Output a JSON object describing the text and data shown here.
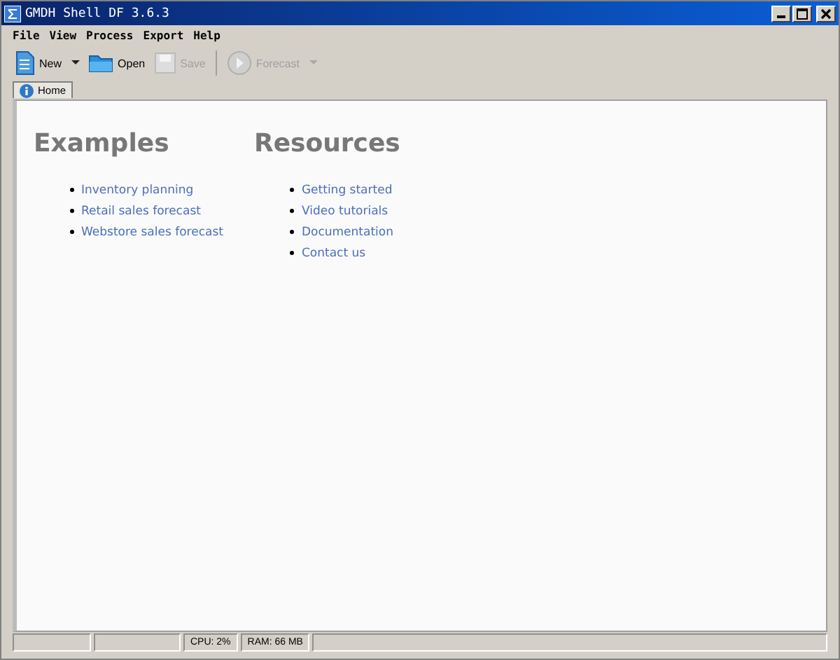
{
  "window": {
    "title": "GMDH Shell DF 3.6.3"
  },
  "menu": [
    "File",
    "View",
    "Process",
    "Export",
    "Help"
  ],
  "toolbar": [
    {
      "label": "New",
      "kind": "new",
      "disabled": false,
      "dropdown": true
    },
    {
      "label": "Open",
      "kind": "open",
      "disabled": false,
      "dropdown": false
    },
    {
      "label": "Save",
      "kind": "save",
      "disabled": true,
      "dropdown": false
    },
    {
      "label": "Forecast",
      "kind": "forecast",
      "disabled": true,
      "dropdown": true
    }
  ],
  "tabs": [
    {
      "label": "Home",
      "selected": true
    }
  ],
  "sections": [
    {
      "heading": "Examples",
      "links": [
        "Inventory planning",
        "Retail sales forecast",
        "Webstore sales forecast"
      ]
    },
    {
      "heading": "Resources",
      "links": [
        "Getting started",
        "Video tutorials",
        "Documentation",
        "Contact us"
      ]
    }
  ],
  "status_bar": [
    "CPU: 2%",
    "RAM: 66 MB"
  ]
}
